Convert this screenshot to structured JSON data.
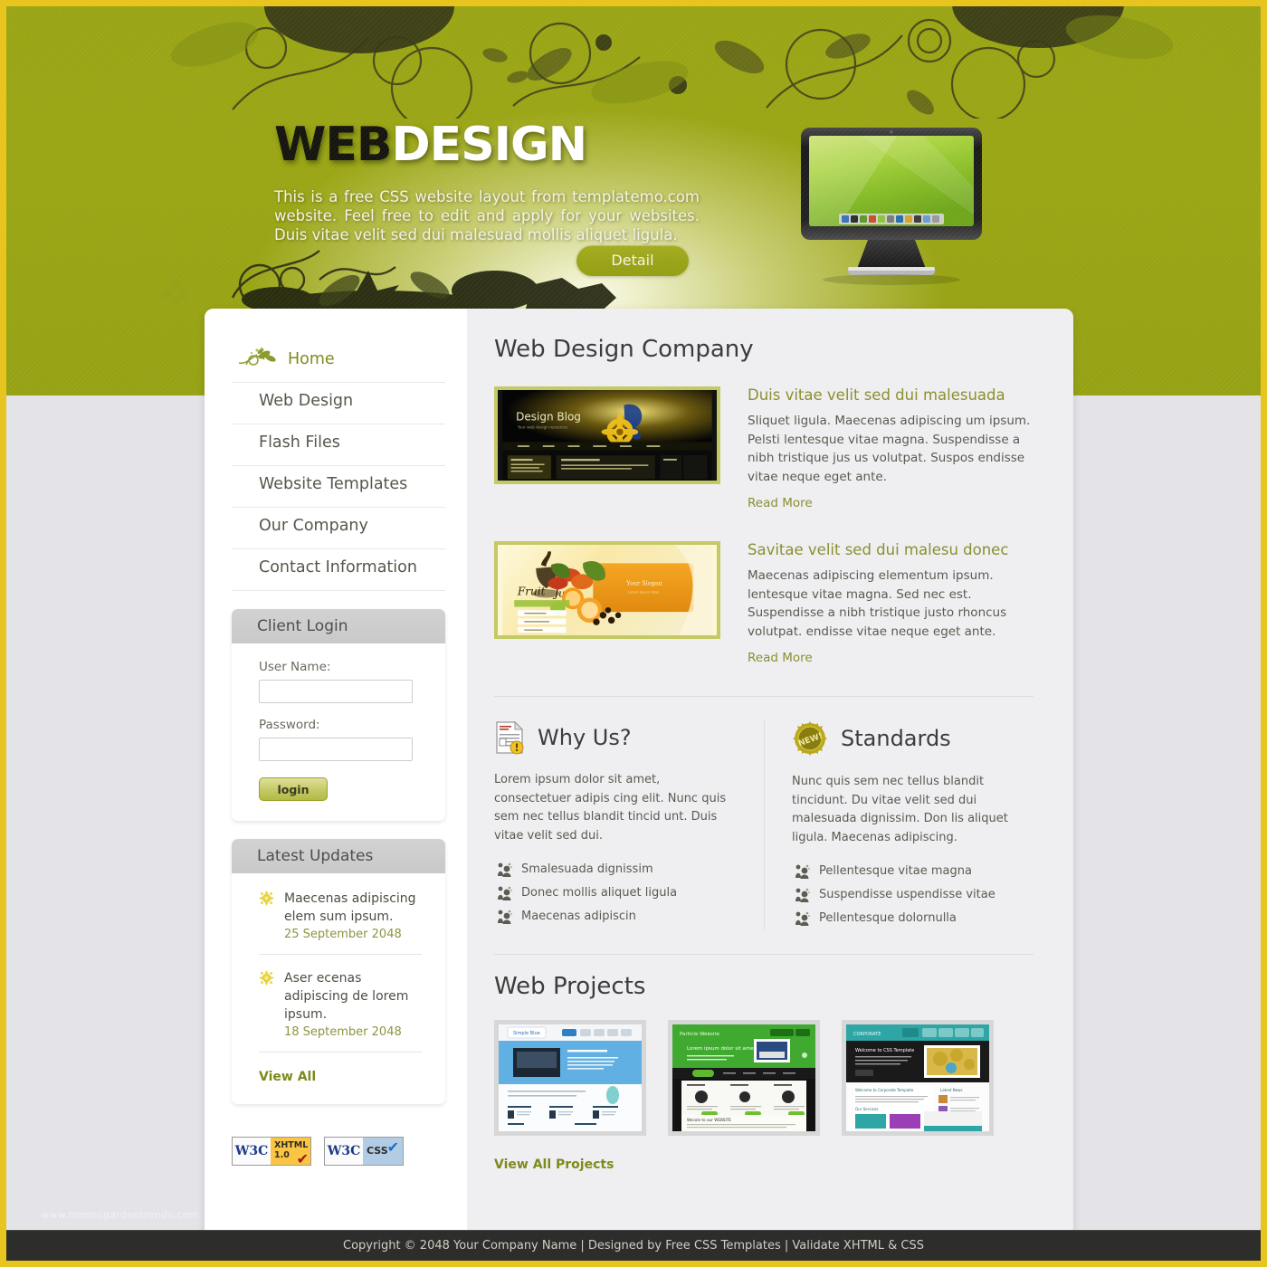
{
  "brand": {
    "title_bold": "WEB",
    "title_light": "DESIGN",
    "tagline": "This is a free CSS website layout from templatemo.com website. Feel free to edit and apply for your websites. Duis vitae velit sed dui malesuad mollis aliquet ligula.",
    "detail_button": "Detail"
  },
  "colors": {
    "header_green": "#9aa516",
    "frame_gold": "#e8c51e",
    "accent_olive": "#8b8f2f",
    "link_olive": "#7e8a1c",
    "panel_grey": "#efeff1",
    "footer_dark": "#2d2d2b"
  },
  "sidebar": {
    "nav": [
      {
        "label": "Home",
        "icon": "leaf-swirl-icon",
        "active": true
      },
      {
        "label": "Web Design",
        "active": false
      },
      {
        "label": "Flash Files",
        "active": false
      },
      {
        "label": "Website Templates",
        "active": false
      },
      {
        "label": "Our Company",
        "active": false
      },
      {
        "label": "Contact Information",
        "active": false
      }
    ],
    "login": {
      "title": "Client Login",
      "username_label": "User Name:",
      "username_value": "",
      "username_placeholder": "",
      "password_label": "Password:",
      "password_value": "",
      "password_placeholder": "",
      "submit_label": "login"
    },
    "updates": {
      "title": "Latest Updates",
      "items": [
        {
          "text": "Maecenas adipiscing elem sum ipsum.",
          "date": "25 September 2048"
        },
        {
          "text": "Aser ecenas adipiscing de lorem ipsum.",
          "date": "18 September 2048"
        }
      ],
      "view_all": "View All"
    },
    "badges": [
      {
        "org": "W3C",
        "tag_line1": "XHTML",
        "tag_line2": "1.0",
        "kind": "xhtml"
      },
      {
        "org": "W3C",
        "tag_line1": "CSS",
        "tag_line2": "",
        "kind": "css"
      }
    ]
  },
  "main": {
    "heading": "Web Design Company",
    "articles": [
      {
        "thumb_label": "Design Blog",
        "thumb_sub": "Your web design resources",
        "title": "Duis vitae velit sed dui malesuada",
        "body": "Sliquet ligula. Maecenas adipiscing um ipsum. Pelsti lentesque vitae magna. Suspendisse a nibh tristique jus us volutpat. Suspos endisse vitae neque eget ante.",
        "read_more": "Read More"
      },
      {
        "thumb_label": "Fruit Juice",
        "thumb_sub": "Your Slogan",
        "title": "Savitae velit sed dui malesu donec",
        "body": "Maecenas adipiscing elementum ipsum. lentesque vitae magna. Sed nec est. Suspendisse a nibh tristique justo rhoncus volutpat. endisse vitae neque eget ante.",
        "read_more": "Read More"
      }
    ],
    "columns": [
      {
        "icon": "document-alert-icon",
        "title": "Why Us?",
        "body": "Lorem ipsum dolor sit amet, consectetuer adipis cing elit. Nunc quis sem nec tellus blandit tincid unt. Duis vitae velit sed dui.",
        "items": [
          "Smalesuada dignissim",
          "Donec mollis aliquet ligula",
          "Maecenas adipiscin"
        ]
      },
      {
        "icon": "new-badge-icon",
        "title": "Standards",
        "body": "Nunc quis sem nec tellus blandit tincidunt. Du vitae velit sed dui malesuada dignissim. Don lis aliquet ligula. Maecenas adipiscing.",
        "items": [
          "Pellentesque vitae magna",
          "Suspendisse uspendisse vitae",
          "Pellentesque dolornulla"
        ]
      }
    ],
    "projects": {
      "heading": "Web Projects",
      "items": [
        {
          "theme": "blue"
        },
        {
          "theme": "green"
        },
        {
          "theme": "teal"
        }
      ],
      "view_all": "View All Projects"
    }
  },
  "footer": {
    "text": "Copyright © 2048 Your Company Name | Designed by Free CSS Templates | Validate XHTML & CSS",
    "watermark": "www.homesgardentrends.com"
  }
}
